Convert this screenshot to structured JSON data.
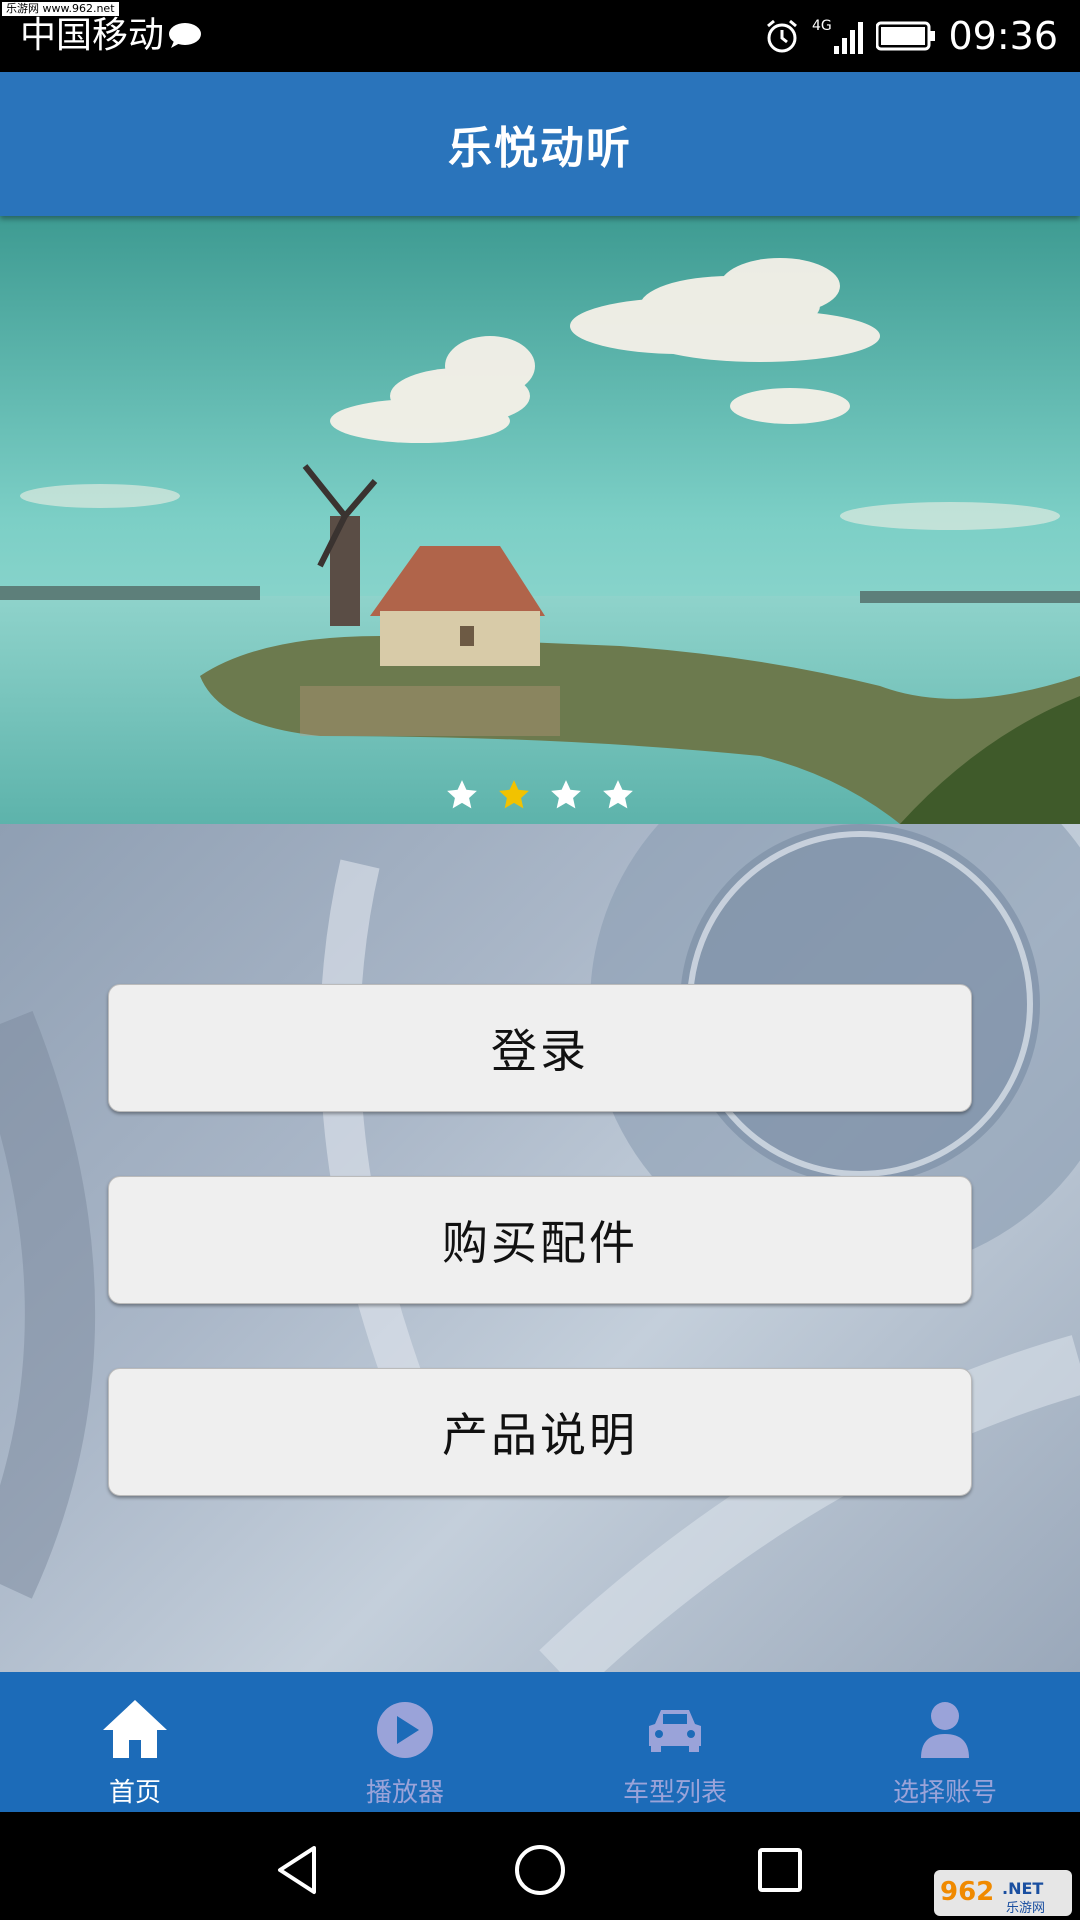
{
  "status_bar": {
    "watermark": "乐游网 www.962.net",
    "carrier": "中国移动",
    "network": "4G",
    "time": "09:36"
  },
  "app": {
    "title": "乐悦动听"
  },
  "banner": {
    "slide_count": 4,
    "active_slide": 2,
    "active_color": "#f2c200",
    "inactive_color": "#ffffff"
  },
  "buttons": {
    "login": "登录",
    "buy_parts": "购买配件",
    "product_info": "产品说明"
  },
  "bottom_nav": {
    "items": [
      {
        "label": "首页",
        "icon": "home-icon",
        "active": true
      },
      {
        "label": "播放器",
        "icon": "play-icon",
        "active": false
      },
      {
        "label": "车型列表",
        "icon": "car-icon",
        "active": false
      },
      {
        "label": "选择账号",
        "icon": "user-icon",
        "active": false
      }
    ]
  },
  "system_nav": {
    "back": "back-icon",
    "home": "home-circle-icon",
    "recents": "recents-icon"
  },
  "corner_logo": {
    "brand": "962",
    "suffix": ".NET",
    "subtitle": "乐游网"
  },
  "colors": {
    "primary": "#2a74bb",
    "nav_bg": "#1c6bb8",
    "inactive_icon": "#9aa3d9"
  }
}
